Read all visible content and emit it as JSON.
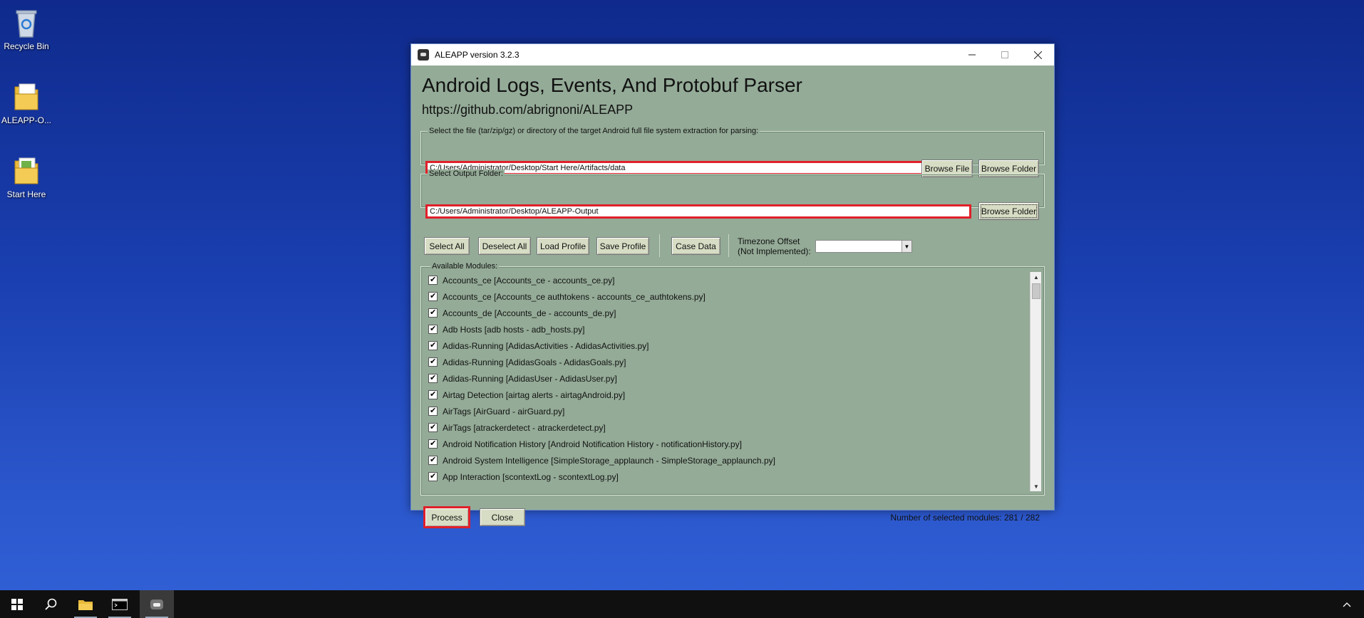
{
  "desktop": {
    "icons": [
      {
        "label": "Recycle Bin"
      },
      {
        "label": "ALEAPP-O..."
      },
      {
        "label": "Start Here"
      }
    ]
  },
  "window": {
    "title": "ALEAPP version 3.2.3",
    "heading": "Android Logs, Events, And Protobuf Parser",
    "url": "https://github.com/abrignoni/ALEAPP",
    "input_group": {
      "label": "Select the file (tar/zip/gz) or directory of the target Android full file system extraction for parsing:",
      "value": "C:/Users/Administrator/Desktop/Start Here/Artifacts/data",
      "browse_file": "Browse File",
      "browse_folder": "Browse Folder"
    },
    "output_group": {
      "label": "Select Output Folder:",
      "value": "C:/Users/Administrator/Desktop/ALEAPP-Output",
      "browse_folder": "Browse Folder"
    },
    "toolbar": {
      "select_all": "Select All",
      "deselect_all": "Deselect All",
      "load_profile": "Load Profile",
      "save_profile": "Save Profile",
      "case_data": "Case Data",
      "timezone_line1": "Timezone Offset",
      "timezone_line2": "(Not Implemented):",
      "timezone_value": ""
    },
    "modules_label": "Available Modules:",
    "modules": [
      "Accounts_ce [Accounts_ce - accounts_ce.py]",
      "Accounts_ce [Accounts_ce authtokens - accounts_ce_authtokens.py]",
      "Accounts_de [Accounts_de - accounts_de.py]",
      "Adb Hosts [adb hosts - adb_hosts.py]",
      "Adidas-Running [AdidasActivities - AdidasActivities.py]",
      "Adidas-Running [AdidasGoals - AdidasGoals.py]",
      "Adidas-Running [AdidasUser - AdidasUser.py]",
      "Airtag Detection [airtag alerts - airtagAndroid.py]",
      "AirTags [AirGuard - airGuard.py]",
      "AirTags [atrackerdetect - atrackerdetect.py]",
      "Android Notification History [Android Notification History - notificationHistory.py]",
      "Android System Intelligence [SimpleStorage_applaunch - SimpleStorage_applaunch.py]",
      "App Interaction [scontextLog - scontextLog.py]"
    ],
    "process_label": "Process",
    "close_label": "Close",
    "selected_count": "Number of selected modules: 281 / 282"
  },
  "colors": {
    "window_bg": "#94ab97",
    "highlight": "#e0202a",
    "button_bg": "#d7ddc4"
  }
}
